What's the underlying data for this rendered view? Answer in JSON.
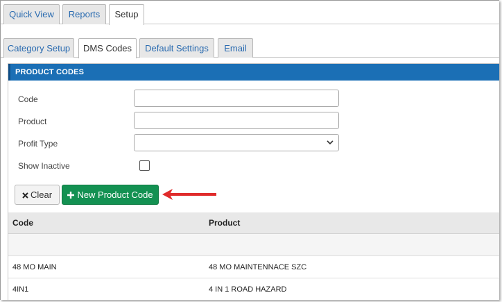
{
  "top_tabs": [
    "Quick View",
    "Reports",
    "Setup"
  ],
  "sub_tabs": [
    "Category Setup",
    "DMS Codes",
    "Default Settings",
    "Email"
  ],
  "panel": {
    "title": "PRODUCT CODES"
  },
  "form": {
    "code_label": "Code",
    "code_value": "",
    "product_label": "Product",
    "product_value": "",
    "profit_type_label": "Profit Type",
    "profit_type_selected": "",
    "show_inactive_label": "Show Inactive",
    "show_inactive_checked": false
  },
  "buttons": {
    "clear_label": "Clear",
    "new_product_code_label": "New Product Code"
  },
  "table": {
    "headers": [
      "Code",
      "Product"
    ],
    "rows": [
      [
        "",
        ""
      ],
      [
        "48 MO MAIN",
        "48 MO MAINTENNACE SZC"
      ],
      [
        "4IN1",
        "4 IN 1 ROAD HAZARD"
      ]
    ]
  },
  "colors": {
    "header_blue": "#1b6fb5",
    "new_button_green": "#139152",
    "annotation_arrow_red": "#e02b2b",
    "tab_link_blue": "#2a6bb0"
  },
  "icons": {
    "clear": "times-icon",
    "new": "plus-icon",
    "select": "chevron-down-icon",
    "annotation": "arrow-left-icon"
  }
}
